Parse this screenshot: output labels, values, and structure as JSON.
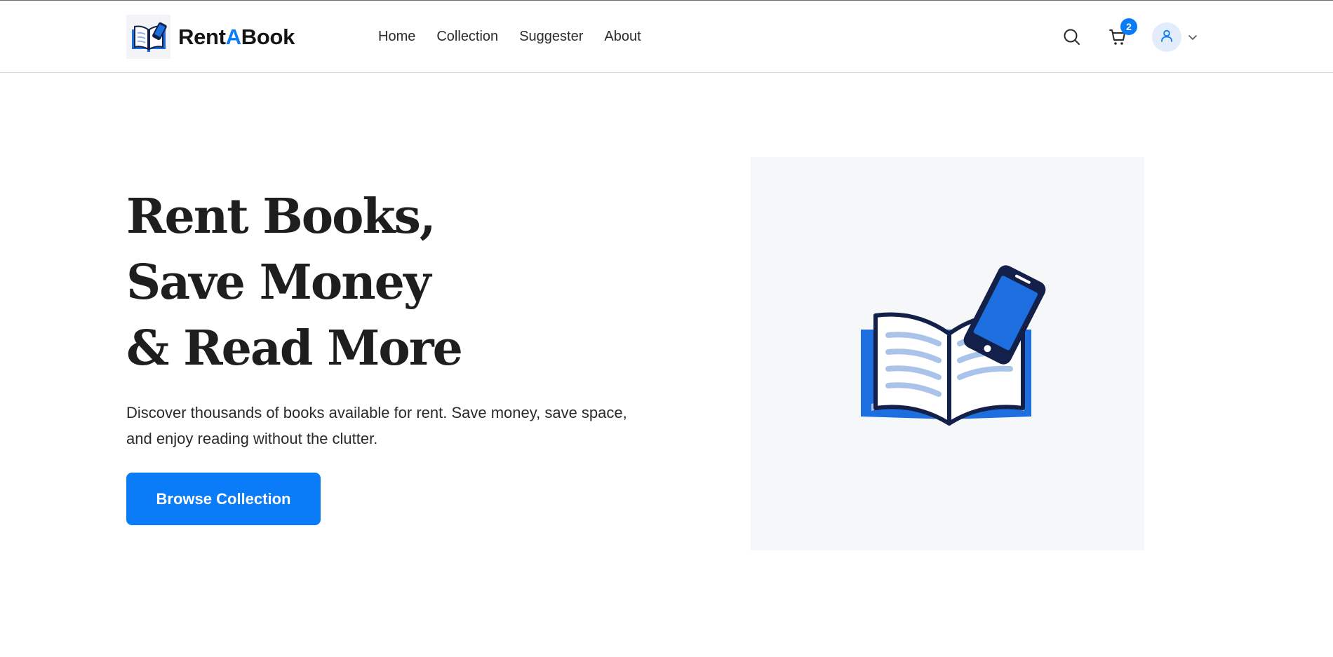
{
  "header": {
    "brand": {
      "part1": "Rent",
      "part2": "A",
      "part3": "Book"
    },
    "nav": [
      {
        "label": "Home"
      },
      {
        "label": "Collection"
      },
      {
        "label": "Suggester"
      },
      {
        "label": "About"
      }
    ],
    "cart_count": "2",
    "icons": [
      "book-logo-icon",
      "search-icon",
      "cart-icon",
      "user-icon",
      "chevron-down-icon"
    ]
  },
  "hero": {
    "title_lines": [
      "Rent Books,",
      "Save Money",
      "& Read More"
    ],
    "description": "Discover thousands of books available for rent. Save money, save space, and enjoy reading without the clutter.",
    "cta_label": "Browse Collection",
    "illustration_icon": "book-phone-icon"
  },
  "colors": {
    "accent": "#0b7cf8",
    "navy": "#13204a",
    "text": "#1e1e1e",
    "image_bg": "#f6f7f8"
  }
}
